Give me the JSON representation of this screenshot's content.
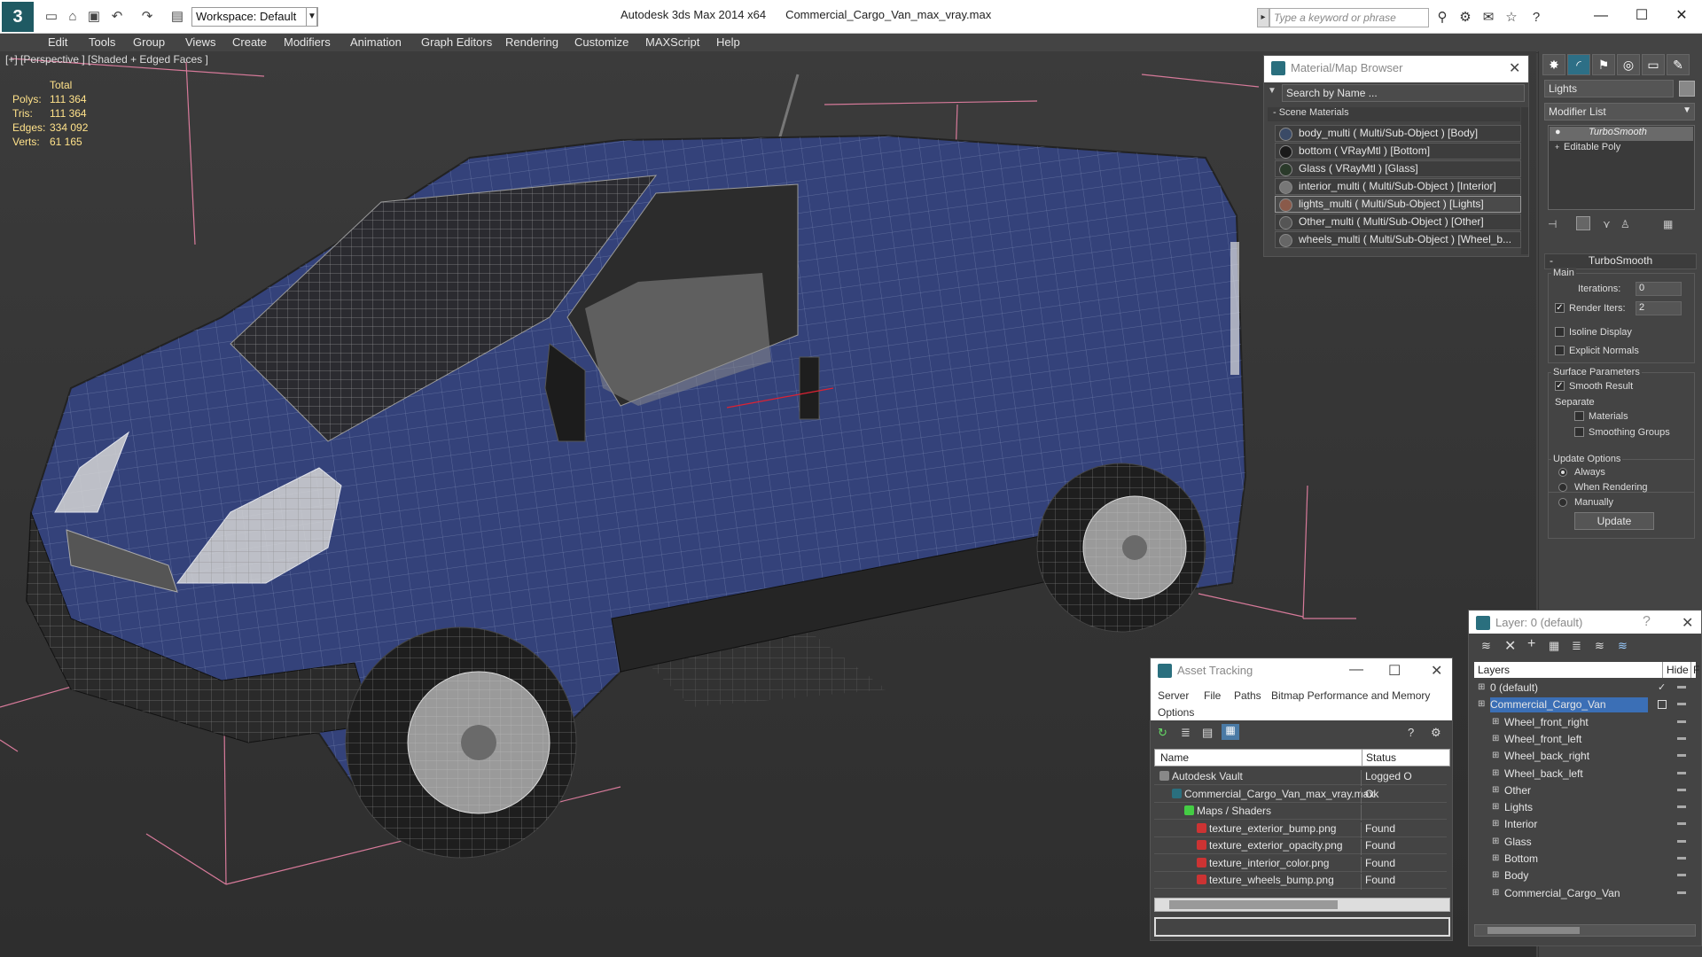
{
  "title_bar": {
    "app_name": "Autodesk 3ds Max  2014 x64",
    "file_name": "Commercial_Cargo_Van_max_vray.max",
    "workspace": "Workspace: Default",
    "search_placeholder": "Type a keyword or phrase"
  },
  "menu": [
    "Edit",
    "Tools",
    "Group",
    "Views",
    "Create",
    "Modifiers",
    "Animation",
    "Graph Editors",
    "Rendering",
    "Customize",
    "MAXScript",
    "Help"
  ],
  "viewport": {
    "label": "[+] [Perspective ] [Shaded + Edged Faces ]",
    "stats_header": "Total",
    "stats": [
      {
        "label": "Polys:",
        "value": "111 364"
      },
      {
        "label": "Tris:",
        "value": "111 364"
      },
      {
        "label": "Edges:",
        "value": "334 092"
      },
      {
        "label": "Verts:",
        "value": "61 165"
      }
    ]
  },
  "material_browser": {
    "title": "Material/Map Browser",
    "search_placeholder": "Search by Name ...",
    "section": "- Scene Materials",
    "materials": [
      {
        "name": "body_multi  ( Multi/Sub-Object ) [Body]",
        "swatch": "#3a4a66"
      },
      {
        "name": "bottom  ( VRayMtl ) [Bottom]",
        "swatch": "#1a1a1a"
      },
      {
        "name": "Glass  ( VRayMtl ) [Glass]",
        "swatch": "#2a3a2a"
      },
      {
        "name": "interior_multi  ( Multi/Sub-Object ) [Interior]",
        "swatch": "#777777"
      },
      {
        "name": "lights_multi  ( Multi/Sub-Object ) [Lights]",
        "swatch": "#8a5a4a"
      },
      {
        "name": "Other_multi  ( Multi/Sub-Object ) [Other]",
        "swatch": "#555555"
      },
      {
        "name": "wheels_multi  ( Multi/Sub-Object ) [Wheel_b...",
        "swatch": "#666666"
      }
    ]
  },
  "command_panel": {
    "object_name": "Lights",
    "modifier_list": "Modifier List",
    "stack": [
      "TurboSmooth",
      "Editable Poly"
    ],
    "rollout_title": "TurboSmooth",
    "main_label": "Main",
    "iterations_label": "Iterations:",
    "iterations_value": "0",
    "render_iters_label": "Render Iters:",
    "render_iters_value": "2",
    "isoline": "Isoline Display",
    "explicit_normals": "Explicit Normals",
    "surface_params": "Surface Parameters",
    "smooth_result": "Smooth Result",
    "separate": "Separate",
    "materials": "Materials",
    "smoothing_groups": "Smoothing Groups",
    "update_options": "Update Options",
    "always": "Always",
    "when_rendering": "When Rendering",
    "manually": "Manually",
    "update_button": "Update"
  },
  "asset_tracking": {
    "title": "Asset Tracking",
    "menu": [
      "Server",
      "File",
      "Paths",
      "Bitmap Performance and Memory"
    ],
    "options": "Options",
    "col_name": "Name",
    "col_status": "Status",
    "rows": [
      {
        "name": "Autodesk Vault",
        "status": "Logged O",
        "indent": 20
      },
      {
        "name": "Commercial_Cargo_Van_max_vray.max",
        "status": "Ok",
        "indent": 34
      },
      {
        "name": "Maps / Shaders",
        "status": "",
        "indent": 48
      },
      {
        "name": "texture_exterior_bump.png",
        "status": "Found",
        "indent": 62
      },
      {
        "name": "texture_exterior_opacity.png",
        "status": "Found",
        "indent": 62
      },
      {
        "name": "texture_interior_color.png",
        "status": "Found",
        "indent": 62
      },
      {
        "name": "texture_wheels_bump.png",
        "status": "Found",
        "indent": 62
      }
    ]
  },
  "layers": {
    "title": "Layer: 0 (default)",
    "help": "?",
    "col_layers": "Layers",
    "col_hide": "Hide",
    "col_f": "F",
    "rows": [
      {
        "name": "0 (default)",
        "indent": 16,
        "check": "✓"
      },
      {
        "name": "Commercial_Cargo_Van",
        "indent": 16,
        "selected": true
      },
      {
        "name": "Wheel_front_right",
        "indent": 32
      },
      {
        "name": "Wheel_front_left",
        "indent": 32
      },
      {
        "name": "Wheel_back_right",
        "indent": 32
      },
      {
        "name": "Wheel_back_left",
        "indent": 32
      },
      {
        "name": "Other",
        "indent": 32
      },
      {
        "name": "Lights",
        "indent": 32
      },
      {
        "name": "Interior",
        "indent": 32
      },
      {
        "name": "Glass",
        "indent": 32
      },
      {
        "name": "Bottom",
        "indent": 32
      },
      {
        "name": "Body",
        "indent": 32
      },
      {
        "name": "Commercial_Cargo_Van",
        "indent": 32
      }
    ]
  }
}
